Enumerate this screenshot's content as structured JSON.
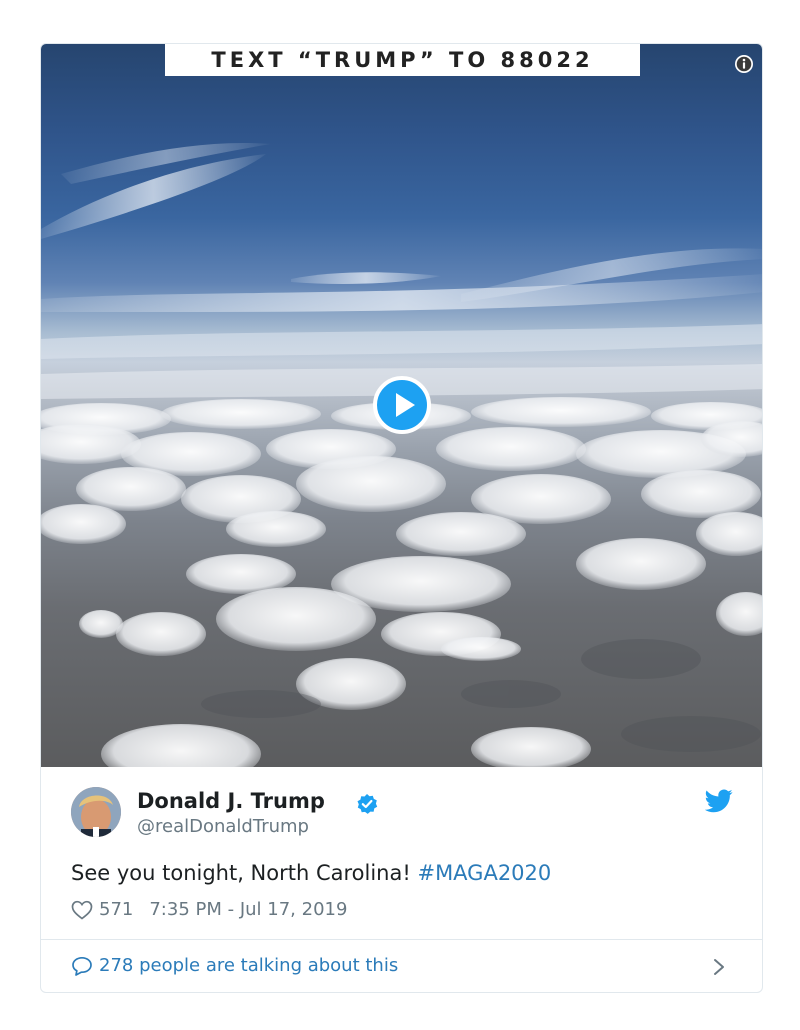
{
  "media": {
    "banner_text": "TEXT “TRUMP” TO 88022",
    "info_icon": "info-icon",
    "play_icon": "play-icon"
  },
  "tweet": {
    "author_name": "Donald J. Trump",
    "author_handle": "@realDonaldTrump",
    "verified_icon": "verified-badge-icon",
    "platform_icon": "twitter-bird-icon",
    "text_main": "See you tonight, North Carolina! ",
    "hashtag": "#MAGA2020",
    "like_count": "571",
    "timestamp": "7:35 PM - Jul 17, 2019",
    "conversation_text": "278 people are talking about this"
  },
  "colors": {
    "link": "#2b7bb9",
    "verified": "#1da1f2",
    "muted": "#697882"
  }
}
